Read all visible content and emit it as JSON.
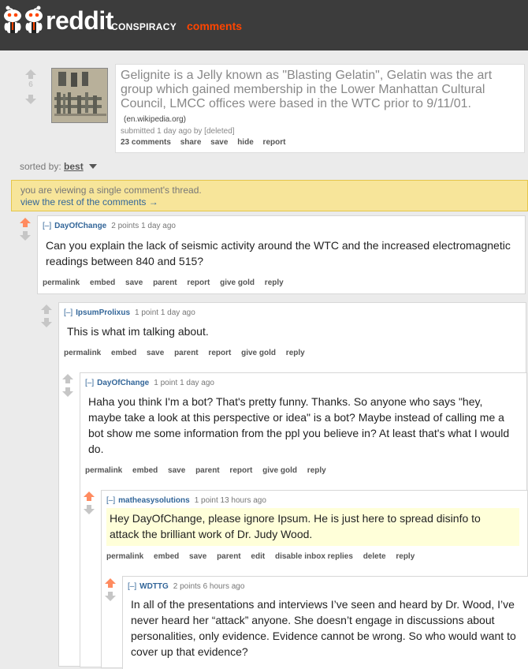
{
  "header": {
    "logo_word": "reddit",
    "subreddit": "CONSPIRACY",
    "page": "comments",
    "accent": "#ff4500"
  },
  "post": {
    "score": "6",
    "title": "Gelignite is a Jelly known as \"Blasting Gelatin\", Gelatin was the art group which gained membership in the Lower Manhattan Cultural Council, LMCC offices were based in the WTC prior to 9/11/01.",
    "domain": "(en.wikipedia.org)",
    "meta": "submitted 1 day ago by [deleted]",
    "buttons": [
      "23 comments",
      "share",
      "save",
      "hide",
      "report"
    ]
  },
  "sort": {
    "label": "sorted by:",
    "value": "best"
  },
  "notice": {
    "line1": "you are viewing a single comment's thread.",
    "line2": "view the rest of the comments →"
  },
  "comments": [
    {
      "toggle": "[–]",
      "author": "DayOfChange",
      "score": "2 points",
      "time": "1 day ago",
      "lines": [
        "Can you explain the lack of seismic activity around the WTC and the increased electromagnetic",
        "readings between 840 and 515?"
      ],
      "buttons": [
        "permalink",
        "embed",
        "save",
        "parent",
        "report",
        "give gold",
        "reply"
      ]
    },
    {
      "toggle": "[–]",
      "author": "IpsumProlixus",
      "score": "1 point",
      "time": "1 day ago",
      "lines": [
        "This is what im talking about."
      ],
      "buttons": [
        "permalink",
        "embed",
        "save",
        "parent",
        "report",
        "give gold",
        "reply"
      ]
    },
    {
      "toggle": "[–]",
      "author": "DayOfChange",
      "score": "1 point",
      "time": "1 day ago",
      "lines": [
        "Haha you think I'm a bot? That's pretty funny. Thanks. So anyone who says \"hey,",
        "maybe take a look at this perspective or idea\" is a bot? Maybe instead of calling me a",
        "bot show me some information from the ppl you believe in? At least that's what I would",
        "do."
      ],
      "buttons": [
        "permalink",
        "embed",
        "save",
        "parent",
        "report",
        "give gold",
        "reply"
      ]
    },
    {
      "toggle": "[–]",
      "author": "matheasysolutions",
      "score": "1 point",
      "time": "13 hours ago",
      "lines": [
        "Hey DayOfChange, please ignore Ipsum. He is just here to spread disinfo to",
        "attack the brilliant work of Dr. Judy Wood."
      ],
      "buttons": [
        "permalink",
        "embed",
        "save",
        "parent",
        "edit",
        "disable inbox replies",
        "delete",
        "reply"
      ]
    },
    {
      "toggle": "[–]",
      "author": "WDTTG",
      "score": "2 points",
      "time": "6 hours ago",
      "lines": [
        "In all of the presentations and interviews I’ve seen and heard by Dr. Wood, I’ve",
        "never heard her “attack” anyone. She doesn’t engage in discussions about",
        "personalities, only evidence. Evidence cannot be wrong. So who would want to",
        "cover up that evidence?"
      ],
      "buttons": []
    }
  ],
  "colors": {
    "upvoted": "#ff8b60",
    "neutral_arrow": "#c6c6c6",
    "link": "#336699",
    "notice_bg": "#f7e59a"
  }
}
